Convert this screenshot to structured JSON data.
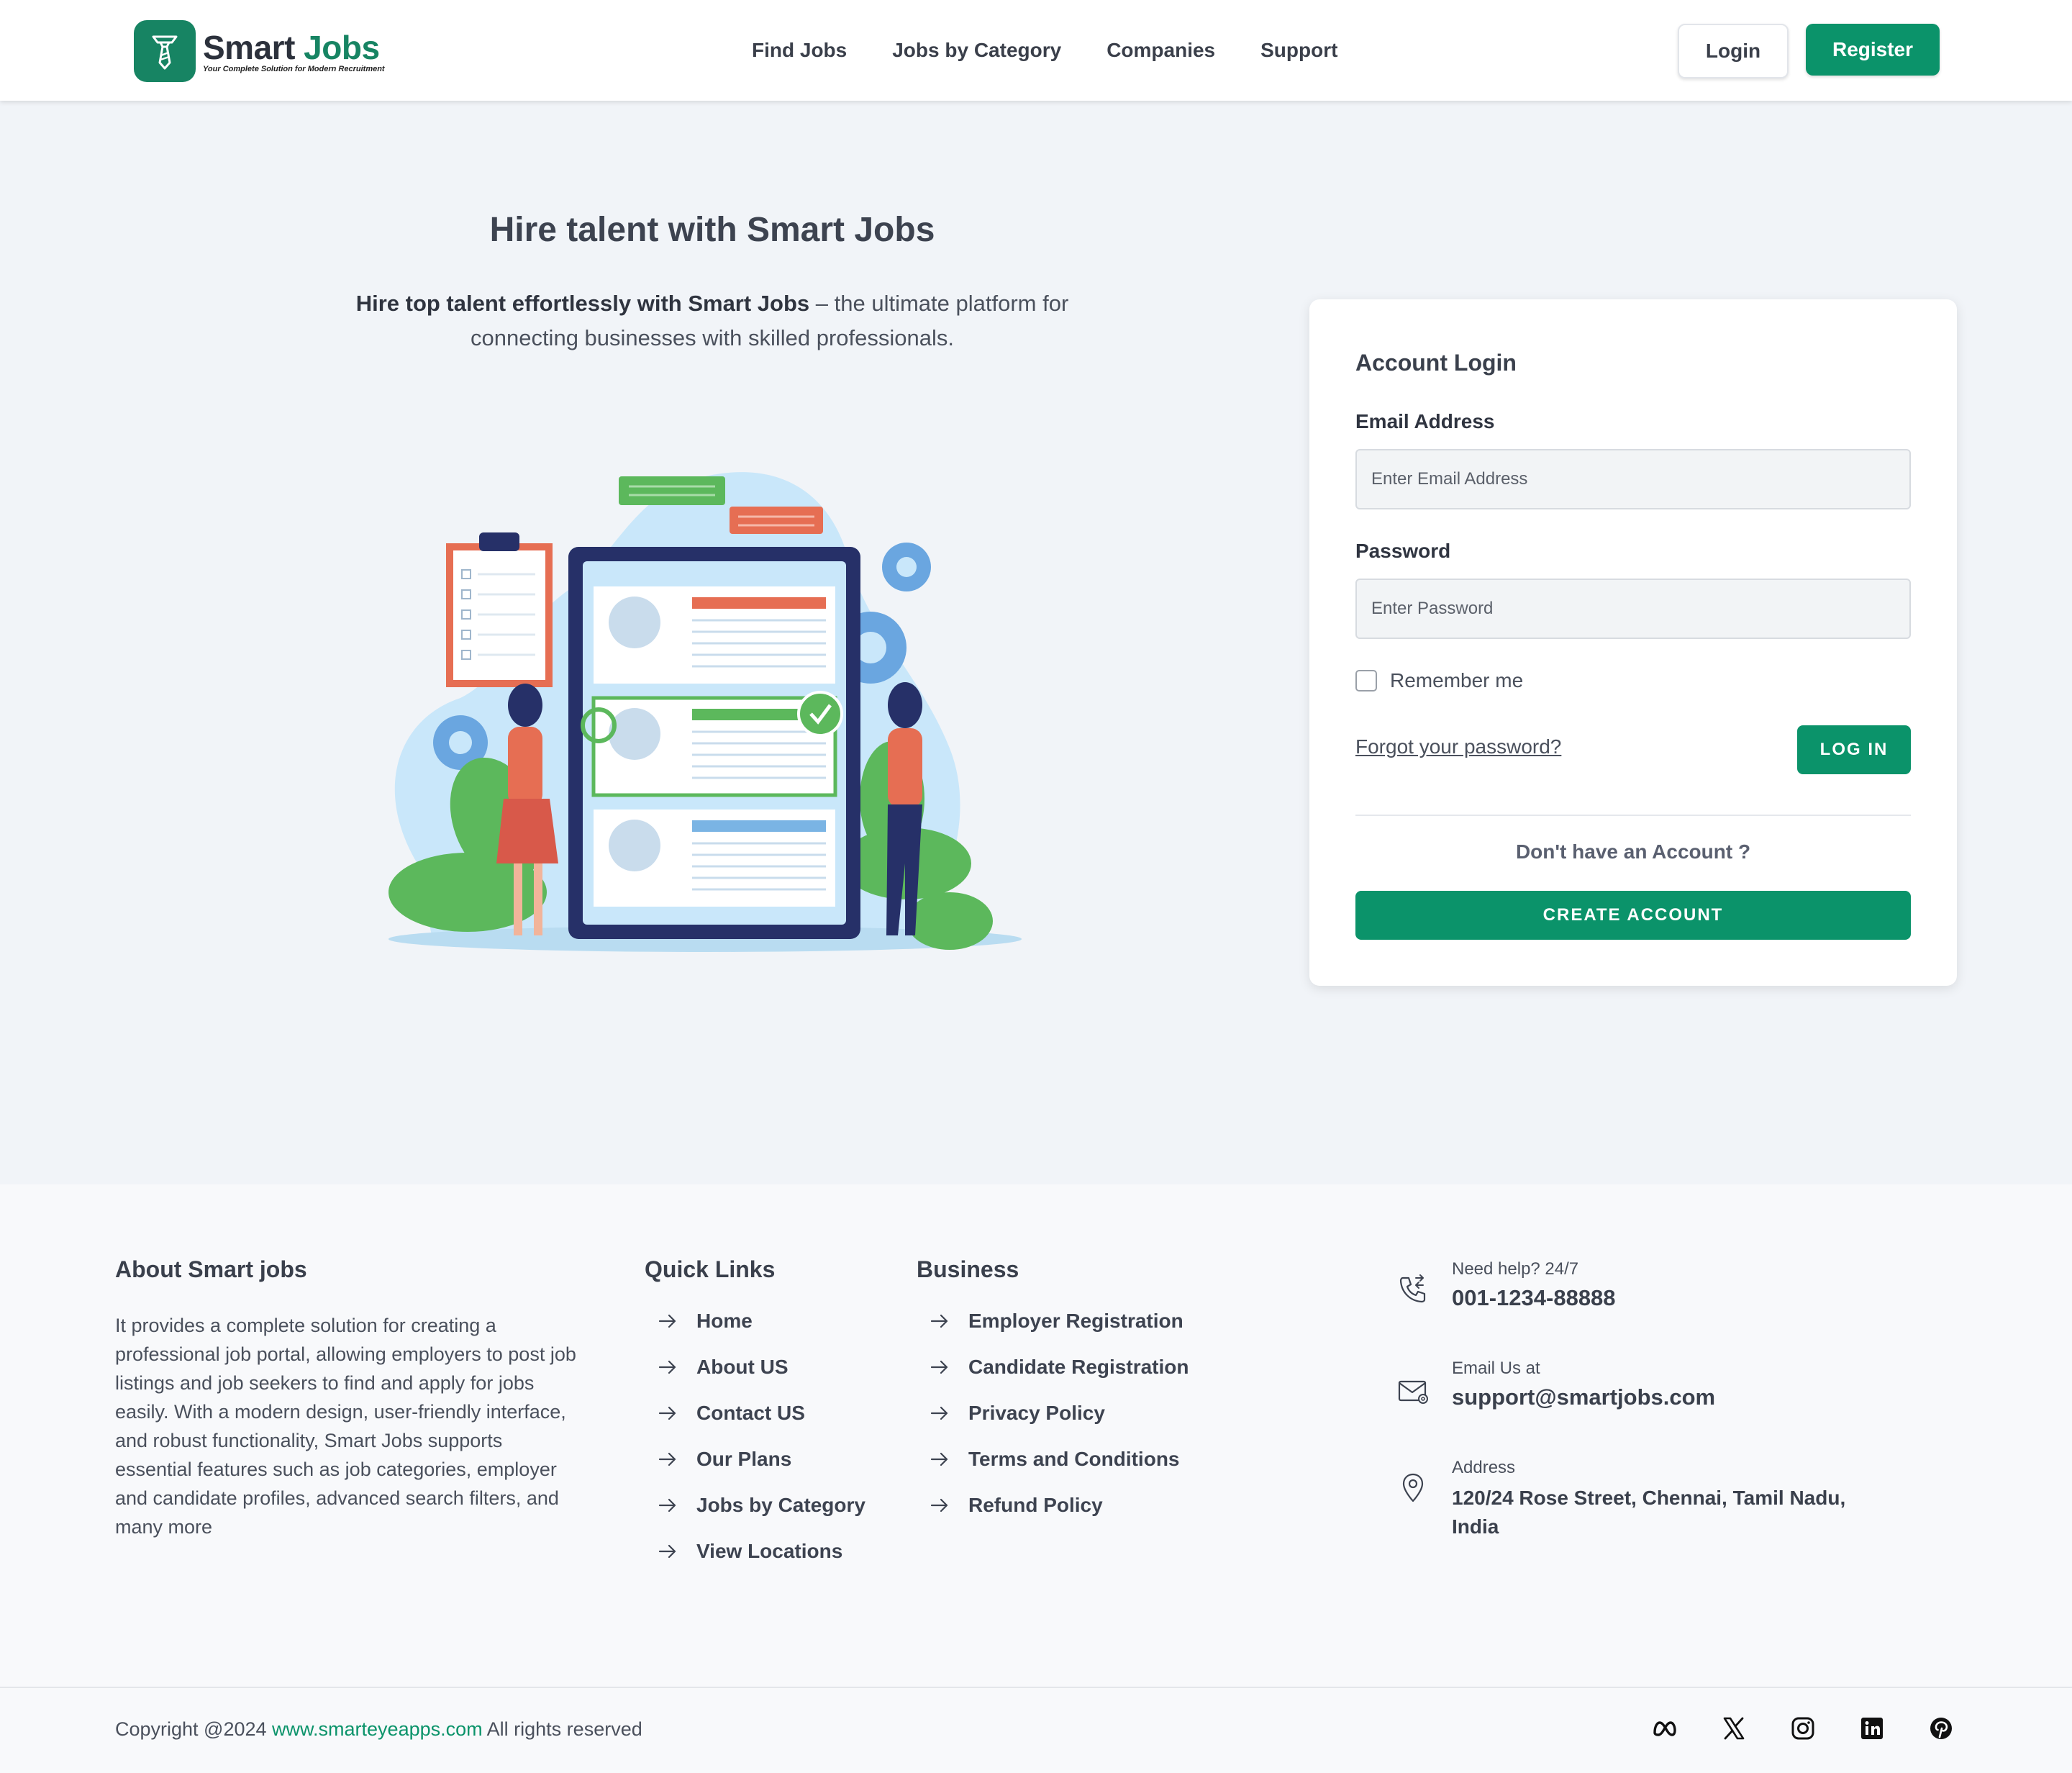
{
  "header": {
    "logo_name_1": "Smart",
    "logo_name_2": "Jobs",
    "logo_tagline": "Your Complete Solution for Modern Recruitment",
    "nav": [
      "Find Jobs",
      "Jobs by Category",
      "Companies",
      "Support"
    ],
    "login_label": "Login",
    "register_label": "Register"
  },
  "hero": {
    "title": "Hire talent with Smart Jobs",
    "desc_bold": "Hire top talent effortlessly with Smart Jobs",
    "desc_rest": " – the ultimate platform for connecting businesses with skilled professionals."
  },
  "login_card": {
    "title": "Account Login",
    "email_label": "Email Address",
    "email_placeholder": "Enter Email Address",
    "password_label": "Password",
    "password_placeholder": "Enter Password",
    "remember_label": "Remember me",
    "forgot_label": "Forgot your password?",
    "login_button": "LOG IN",
    "no_account": "Don't have an Account ?",
    "create_button": "CREATE ACCOUNT"
  },
  "footer": {
    "about_title": "About Smart jobs",
    "about_text": "It provides a complete solution for creating a professional job portal, allowing employers to post job listings and job seekers to find and apply for jobs easily. With a modern design, user-friendly interface, and robust functionality, Smart Jobs supports essential features such as job categories, employer and candidate profiles, advanced search filters, and many more",
    "quick_title": "Quick Links",
    "quick_links": [
      "Home",
      "About US",
      "Contact US",
      "Our Plans",
      "Jobs by Category",
      "View Locations"
    ],
    "business_title": "Business",
    "business_links": [
      "Employer Registration",
      "Candidate Registration",
      "Privacy Policy",
      "Terms and Conditions",
      "Refund Policy"
    ],
    "help_label": "Need help? 24/7",
    "phone": "001-1234-88888",
    "email_label": "Email Us at",
    "email": "support@smartjobs.com",
    "address_label": "Address",
    "address": "120/24 Rose Street, Chennai, Tamil Nadu, India"
  },
  "bottom": {
    "copyright_prefix": "Copyright @2024 ",
    "site": "www.smarteyeapps.com",
    "copyright_suffix": " All rights reserved"
  },
  "colors": {
    "brand": "#0b936a",
    "page_bg": "#f1f4f8",
    "footer_bg": "#f8f9fb"
  },
  "icons": [
    "tie-logo-icon",
    "arrow-right-icon",
    "phone-icon",
    "mail-icon",
    "location-pin-icon",
    "meta-icon",
    "x-icon",
    "instagram-icon",
    "linkedin-icon",
    "pinterest-icon"
  ]
}
